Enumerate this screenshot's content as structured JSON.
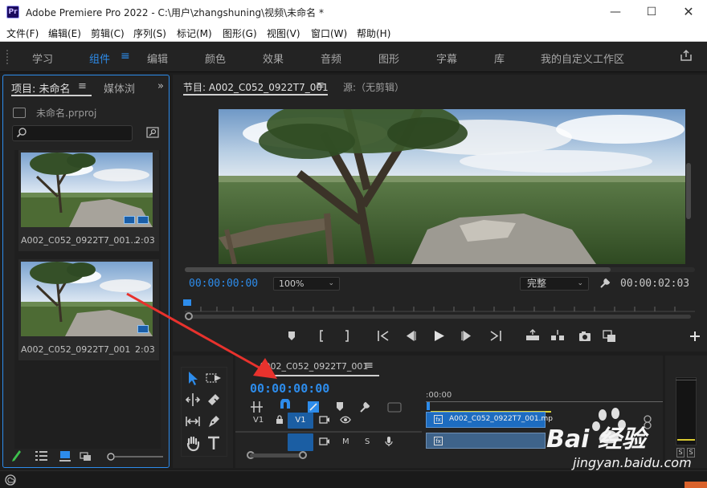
{
  "window": {
    "title": "Adobe Premiere Pro 2022 - C:\\用户\\zhangshuning\\视频\\未命名 *",
    "logo_text": "Pr",
    "min_glyph": "—",
    "max_glyph": "☐",
    "close_glyph": "✕"
  },
  "menu": [
    "文件(F)",
    "编辑(E)",
    "剪辑(C)",
    "序列(S)",
    "标记(M)",
    "图形(G)",
    "视图(V)",
    "窗口(W)",
    "帮助(H)"
  ],
  "workspaces": {
    "tabs": [
      "学习",
      "组件",
      "编辑",
      "颜色",
      "效果",
      "音频",
      "图形",
      "字幕",
      "库",
      "我的自定义工作区"
    ],
    "active": "组件",
    "menu_glyph": "≡"
  },
  "project": {
    "tab_label": "项目: 未命名",
    "tab_menu_glyph": "≡",
    "media_tab": "媒体浏",
    "more_glyph": "»",
    "file_name": "未命名.prproj",
    "search_value": "",
    "clips": [
      {
        "name": "A002_C052_0922T7_001...",
        "duration": "2:03"
      },
      {
        "name": "A002_C052_0922T7_001",
        "duration": "2:03"
      }
    ]
  },
  "program": {
    "tab_label": "节目: A002_C052_0922T7_001",
    "tab_menu_glyph": "≡",
    "source_tab": "源:（无剪辑）",
    "timecode": "00:00:00:00",
    "zoom": "100%",
    "quality": "完整",
    "duration": "00:00:02:03",
    "select_chevron": "⌄"
  },
  "timeline": {
    "tab_label": "A002_C052_0922T7_001",
    "tab_menu_glyph": "≡",
    "timecode": "00:00:00:00",
    "ruler_start": ":00:00",
    "v1_label": "V1",
    "v1_button": "V1",
    "a_mute": "M",
    "a_solo": "S",
    "video_clip_name": "A002_C052_0922T7_001.mp",
    "clip_fx": "fx",
    "meter_solo_left": "S",
    "meter_solo_right": "S"
  },
  "watermark": {
    "logo_text": "Bai 经验",
    "url": "jingyan.baidu.com"
  },
  "colors": {
    "accent": "#2d8ceb",
    "annotation_arrow": "#e8322d",
    "status_accent": "#d9622b"
  }
}
